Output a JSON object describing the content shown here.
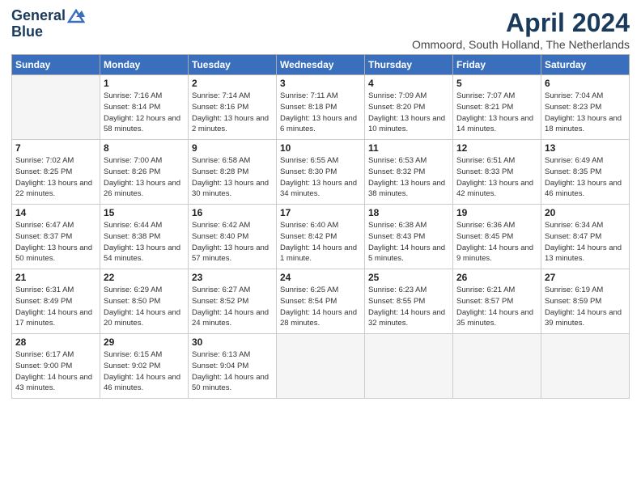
{
  "header": {
    "logo_line1": "General",
    "logo_line2": "Blue",
    "month_title": "April 2024",
    "location": "Ommoord, South Holland, The Netherlands"
  },
  "weekdays": [
    "Sunday",
    "Monday",
    "Tuesday",
    "Wednesday",
    "Thursday",
    "Friday",
    "Saturday"
  ],
  "weeks": [
    [
      {
        "day": "",
        "sunrise": "",
        "sunset": "",
        "daylight": ""
      },
      {
        "day": "1",
        "sunrise": "Sunrise: 7:16 AM",
        "sunset": "Sunset: 8:14 PM",
        "daylight": "Daylight: 12 hours and 58 minutes."
      },
      {
        "day": "2",
        "sunrise": "Sunrise: 7:14 AM",
        "sunset": "Sunset: 8:16 PM",
        "daylight": "Daylight: 13 hours and 2 minutes."
      },
      {
        "day": "3",
        "sunrise": "Sunrise: 7:11 AM",
        "sunset": "Sunset: 8:18 PM",
        "daylight": "Daylight: 13 hours and 6 minutes."
      },
      {
        "day": "4",
        "sunrise": "Sunrise: 7:09 AM",
        "sunset": "Sunset: 8:20 PM",
        "daylight": "Daylight: 13 hours and 10 minutes."
      },
      {
        "day": "5",
        "sunrise": "Sunrise: 7:07 AM",
        "sunset": "Sunset: 8:21 PM",
        "daylight": "Daylight: 13 hours and 14 minutes."
      },
      {
        "day": "6",
        "sunrise": "Sunrise: 7:04 AM",
        "sunset": "Sunset: 8:23 PM",
        "daylight": "Daylight: 13 hours and 18 minutes."
      }
    ],
    [
      {
        "day": "7",
        "sunrise": "Sunrise: 7:02 AM",
        "sunset": "Sunset: 8:25 PM",
        "daylight": "Daylight: 13 hours and 22 minutes."
      },
      {
        "day": "8",
        "sunrise": "Sunrise: 7:00 AM",
        "sunset": "Sunset: 8:26 PM",
        "daylight": "Daylight: 13 hours and 26 minutes."
      },
      {
        "day": "9",
        "sunrise": "Sunrise: 6:58 AM",
        "sunset": "Sunset: 8:28 PM",
        "daylight": "Daylight: 13 hours and 30 minutes."
      },
      {
        "day": "10",
        "sunrise": "Sunrise: 6:55 AM",
        "sunset": "Sunset: 8:30 PM",
        "daylight": "Daylight: 13 hours and 34 minutes."
      },
      {
        "day": "11",
        "sunrise": "Sunrise: 6:53 AM",
        "sunset": "Sunset: 8:32 PM",
        "daylight": "Daylight: 13 hours and 38 minutes."
      },
      {
        "day": "12",
        "sunrise": "Sunrise: 6:51 AM",
        "sunset": "Sunset: 8:33 PM",
        "daylight": "Daylight: 13 hours and 42 minutes."
      },
      {
        "day": "13",
        "sunrise": "Sunrise: 6:49 AM",
        "sunset": "Sunset: 8:35 PM",
        "daylight": "Daylight: 13 hours and 46 minutes."
      }
    ],
    [
      {
        "day": "14",
        "sunrise": "Sunrise: 6:47 AM",
        "sunset": "Sunset: 8:37 PM",
        "daylight": "Daylight: 13 hours and 50 minutes."
      },
      {
        "day": "15",
        "sunrise": "Sunrise: 6:44 AM",
        "sunset": "Sunset: 8:38 PM",
        "daylight": "Daylight: 13 hours and 54 minutes."
      },
      {
        "day": "16",
        "sunrise": "Sunrise: 6:42 AM",
        "sunset": "Sunset: 8:40 PM",
        "daylight": "Daylight: 13 hours and 57 minutes."
      },
      {
        "day": "17",
        "sunrise": "Sunrise: 6:40 AM",
        "sunset": "Sunset: 8:42 PM",
        "daylight": "Daylight: 14 hours and 1 minute."
      },
      {
        "day": "18",
        "sunrise": "Sunrise: 6:38 AM",
        "sunset": "Sunset: 8:43 PM",
        "daylight": "Daylight: 14 hours and 5 minutes."
      },
      {
        "day": "19",
        "sunrise": "Sunrise: 6:36 AM",
        "sunset": "Sunset: 8:45 PM",
        "daylight": "Daylight: 14 hours and 9 minutes."
      },
      {
        "day": "20",
        "sunrise": "Sunrise: 6:34 AM",
        "sunset": "Sunset: 8:47 PM",
        "daylight": "Daylight: 14 hours and 13 minutes."
      }
    ],
    [
      {
        "day": "21",
        "sunrise": "Sunrise: 6:31 AM",
        "sunset": "Sunset: 8:49 PM",
        "daylight": "Daylight: 14 hours and 17 minutes."
      },
      {
        "day": "22",
        "sunrise": "Sunrise: 6:29 AM",
        "sunset": "Sunset: 8:50 PM",
        "daylight": "Daylight: 14 hours and 20 minutes."
      },
      {
        "day": "23",
        "sunrise": "Sunrise: 6:27 AM",
        "sunset": "Sunset: 8:52 PM",
        "daylight": "Daylight: 14 hours and 24 minutes."
      },
      {
        "day": "24",
        "sunrise": "Sunrise: 6:25 AM",
        "sunset": "Sunset: 8:54 PM",
        "daylight": "Daylight: 14 hours and 28 minutes."
      },
      {
        "day": "25",
        "sunrise": "Sunrise: 6:23 AM",
        "sunset": "Sunset: 8:55 PM",
        "daylight": "Daylight: 14 hours and 32 minutes."
      },
      {
        "day": "26",
        "sunrise": "Sunrise: 6:21 AM",
        "sunset": "Sunset: 8:57 PM",
        "daylight": "Daylight: 14 hours and 35 minutes."
      },
      {
        "day": "27",
        "sunrise": "Sunrise: 6:19 AM",
        "sunset": "Sunset: 8:59 PM",
        "daylight": "Daylight: 14 hours and 39 minutes."
      }
    ],
    [
      {
        "day": "28",
        "sunrise": "Sunrise: 6:17 AM",
        "sunset": "Sunset: 9:00 PM",
        "daylight": "Daylight: 14 hours and 43 minutes."
      },
      {
        "day": "29",
        "sunrise": "Sunrise: 6:15 AM",
        "sunset": "Sunset: 9:02 PM",
        "daylight": "Daylight: 14 hours and 46 minutes."
      },
      {
        "day": "30",
        "sunrise": "Sunrise: 6:13 AM",
        "sunset": "Sunset: 9:04 PM",
        "daylight": "Daylight: 14 hours and 50 minutes."
      },
      {
        "day": "",
        "sunrise": "",
        "sunset": "",
        "daylight": ""
      },
      {
        "day": "",
        "sunrise": "",
        "sunset": "",
        "daylight": ""
      },
      {
        "day": "",
        "sunrise": "",
        "sunset": "",
        "daylight": ""
      },
      {
        "day": "",
        "sunrise": "",
        "sunset": "",
        "daylight": ""
      }
    ]
  ]
}
